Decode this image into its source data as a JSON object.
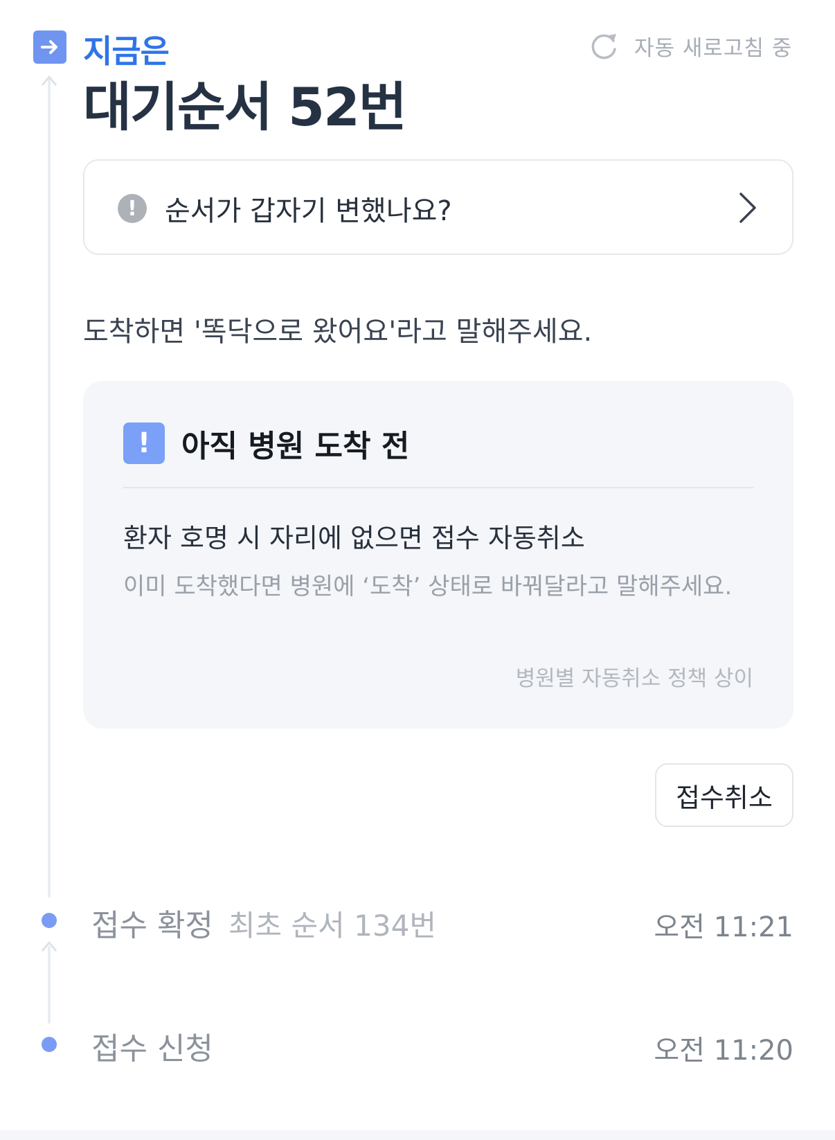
{
  "header": {
    "now_label": "지금은",
    "refresh_text": "자동 새로고침 중",
    "queue_title": "대기순서 52번"
  },
  "question_card": {
    "text": "순서가 갑자기 변했나요?"
  },
  "arrival_note": "도착하면 '똑닥으로 왔어요'라고 말해주세요.",
  "warning": {
    "title": "아직 병원 도착 전",
    "headline": "환자 호명 시 자리에 없으면 접수 자동취소",
    "description": "이미 도착했다면 병원에 ‘도착’ 상태로 바꿔달라고 말해주세요.",
    "policy_note": "병원별 자동취소 정책 상이"
  },
  "cancel_button": "접수취소",
  "timeline": [
    {
      "label": "접수 확정",
      "sub": "최초 순서 134번",
      "time": "오전 11:21"
    },
    {
      "label": "접수 신청",
      "sub": "",
      "time": "오전 11:20"
    }
  ],
  "colors": {
    "accent": "#2f74e8",
    "badge": "#6f95f1",
    "dot": "#7b9cf4",
    "warning_icon": "#7aa1f7"
  }
}
